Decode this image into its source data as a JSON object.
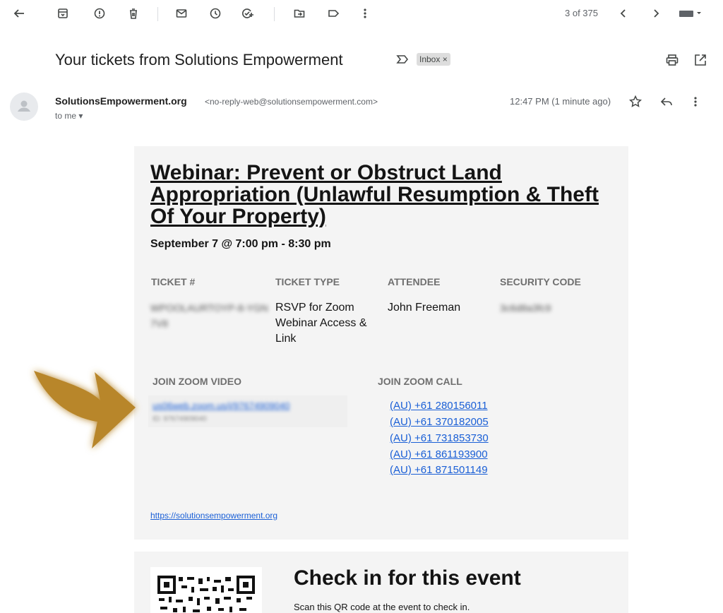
{
  "toolbar": {
    "pager": "3 of 375"
  },
  "message": {
    "subject": "Your tickets from Solutions Empowerment",
    "label_chip": "Inbox ×",
    "sender_name": "SolutionsEmpowerment.org",
    "sender_email": "<no-reply-web@solutionsempowerment.com>",
    "recipient": "to me",
    "time": "12:47 PM (1 minute ago)"
  },
  "ticket": {
    "title": "Webinar: Prevent or Obstruct Land Appropriation (Unlawful Resumption & Theft Of Your Property)",
    "date": "September 7 @ 7:00 pm - 8:30 pm",
    "headers": {
      "ticket": "TICKET #",
      "type": "TICKET TYPE",
      "attendee": "ATTENDEE",
      "security": "SECURITY CODE"
    },
    "ticket_number": "WPOOLAURTOYP-8-YGN7V8",
    "ticket_type": "RSVP for Zoom Webinar Access & Link",
    "attendee": "John Freeman",
    "security_code": "3c6d8a3fc9"
  },
  "join": {
    "video_header": "JOIN ZOOM VIDEO",
    "call_header": "JOIN ZOOM CALL",
    "video_link": "us06web.zoom.us/j/97674909040",
    "video_id": "ID: 97674909040",
    "phones": [
      "(AU) +61 280156011",
      "(AU) +61 370182005",
      "(AU) +61 731853730",
      "(AU) +61 861193900",
      "(AU) +61 871501149"
    ]
  },
  "footer_link": "https://solutionsempowerment.org",
  "checkin": {
    "title": "Check in for this event",
    "subtitle": "Scan this QR code at the event to check in."
  },
  "colors": {
    "accent_link": "#1a5fd6",
    "arrow": "#b8862a",
    "card_bg": "#f4f4f4"
  }
}
